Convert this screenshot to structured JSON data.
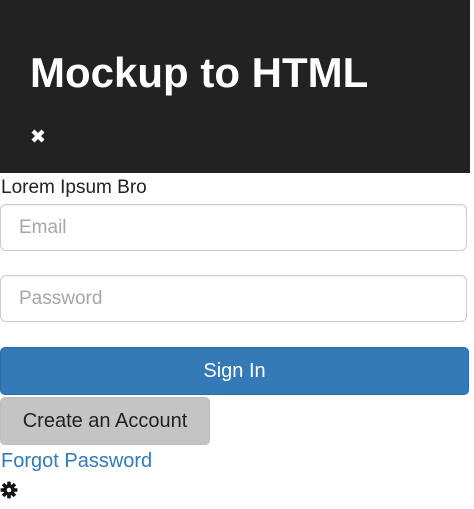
{
  "header": {
    "title": "Mockup to HTML",
    "close_icon": "close-icon",
    "background_color": "#222222"
  },
  "tagline": "Lorem Ipsum Bro",
  "form": {
    "email": {
      "placeholder": "Email",
      "value": ""
    },
    "password": {
      "placeholder": "Password",
      "value": ""
    },
    "sign_in_label": "Sign In",
    "create_account_label": "Create an Account",
    "forgot_password_label": "Forgot Password"
  },
  "footer": {
    "settings_icon": "gear-icon"
  },
  "colors": {
    "primary": "#337ab7",
    "secondary_button": "#c4c4c4",
    "text": "#222222"
  }
}
